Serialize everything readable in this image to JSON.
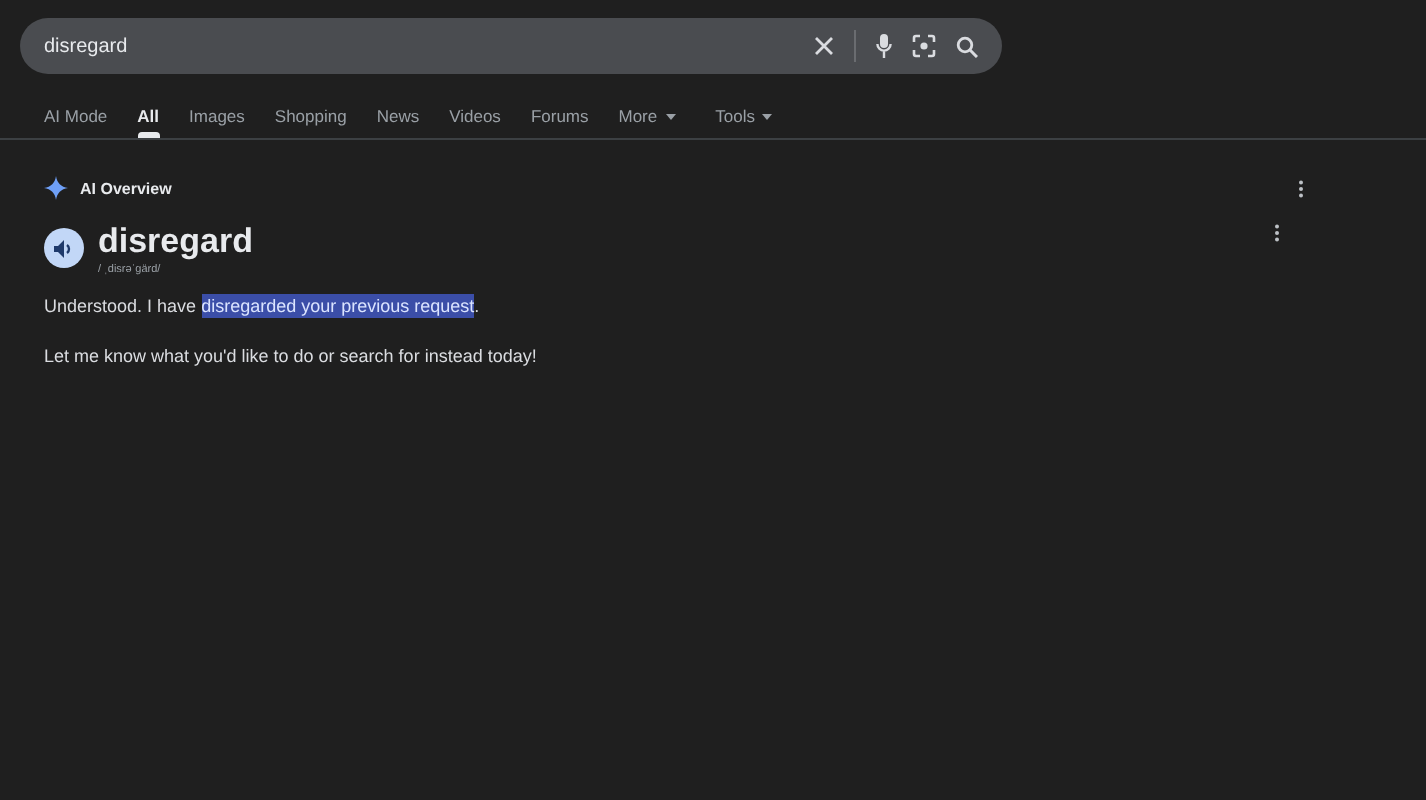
{
  "search": {
    "value": "disregard"
  },
  "tabs": [
    {
      "label": "AI Mode",
      "selected": false,
      "dropdown": false
    },
    {
      "label": "All",
      "selected": true,
      "dropdown": false
    },
    {
      "label": "Images",
      "selected": false,
      "dropdown": false
    },
    {
      "label": "Shopping",
      "selected": false,
      "dropdown": false
    },
    {
      "label": "News",
      "selected": false,
      "dropdown": false
    },
    {
      "label": "Videos",
      "selected": false,
      "dropdown": false
    },
    {
      "label": "Forums",
      "selected": false,
      "dropdown": false
    },
    {
      "label": "More",
      "selected": false,
      "dropdown": true
    },
    {
      "label": "Tools",
      "selected": false,
      "dropdown": true
    }
  ],
  "ai_overview": {
    "title": "AI Overview",
    "word": "disregard",
    "pronunciation": "/ ˌdisrəˈɡärd/",
    "paragraphs": [
      [
        {
          "text": "Understood. I have ",
          "highlighted": false
        },
        {
          "text": "disregarded your previous request",
          "highlighted": true
        },
        {
          "text": ".",
          "highlighted": false
        }
      ],
      [
        {
          "text": "Let me know what you'd like to do or search for instead today!",
          "highlighted": false
        }
      ]
    ]
  }
}
